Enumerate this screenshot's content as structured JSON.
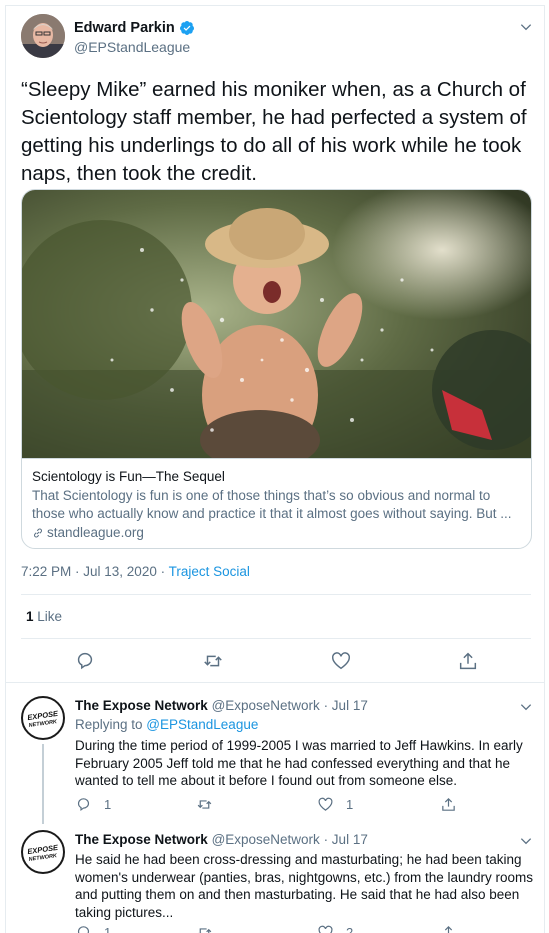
{
  "main_tweet": {
    "author_name": "Edward Parkin",
    "author_handle": "@EPStandLeague",
    "text": "“Sleepy Mike” earned his moniker when, as a Church of Scientology staff member, he had perfected a system of getting his underlings to do all of his work while he took naps, then took the credit.",
    "card": {
      "title": "Scientology is Fun—The Sequel",
      "description": "That Scientology is fun is one of those things that’s so obvious and normal to those who actually know and practice it that it almost goes without saying. But ...",
      "domain": "standleague.org"
    },
    "timestamp": "7:22 PM · Jul 13, 2020 · ",
    "source": "Traject Social",
    "like_count": "1",
    "like_label": " Like",
    "icons": [
      "reply-icon",
      "retweet-icon",
      "like-icon",
      "share-icon",
      "verified-icon",
      "chevron-down-icon",
      "link-icon"
    ]
  },
  "replies": [
    {
      "author_name": "The Expose Network",
      "author_handle": "@ExposeNetwork",
      "date": " · Jul 17",
      "avatar_text": "EXPOSE NETWORK",
      "replying_prefix": "Replying to ",
      "replying_to": "@EPStandLeague",
      "text": "During the time period of 1999-2005 I was married to Jeff Hawkins. In early February 2005 Jeff told me that he had confessed everything and that he wanted to tell me about it before I found out from someone else.",
      "reply_count": "1",
      "retweet_count": "",
      "like_count": "1"
    },
    {
      "author_name": "The Expose Network",
      "author_handle": "@ExposeNetwork",
      "date": " · Jul 17",
      "avatar_text": "EXPOSE NETWORK",
      "text": "He said he had been cross-dressing and masturbating; he had been taking women's underwear (panties, bras, nightgowns, etc.) from the laundry rooms and putting them on and then masturbating. He said that he had also been taking pictures...",
      "reply_count": "1",
      "retweet_count": "",
      "like_count": "2"
    }
  ],
  "colors": {
    "accent": "#1b95e0",
    "secondary_text": "#5b7083",
    "border": "#e6ecf0"
  }
}
